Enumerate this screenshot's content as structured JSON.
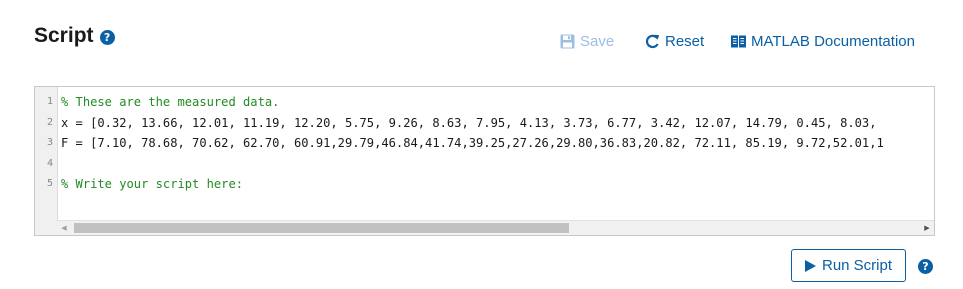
{
  "header": {
    "title": "Script",
    "help_icon": "question-circle-icon",
    "save_label": "Save",
    "reset_label": "Reset",
    "doc_label": "MATLAB Documentation"
  },
  "editor": {
    "lines": [
      {
        "num": "1",
        "text": "% These are the measured data.",
        "comment": true
      },
      {
        "num": "2",
        "text": "x = [0.32, 13.66, 12.01, 11.19, 12.20, 5.75, 9.26, 8.63, 7.95, 4.13, 3.73, 6.77, 3.42, 12.07, 14.79, 0.45, 8.03,",
        "comment": false
      },
      {
        "num": "3",
        "text": "F = [7.10, 78.68, 70.62, 62.70, 60.91,29.79,46.84,41.74,39.25,27.26,29.80,36.83,20.82, 72.11, 85.19, 9.72,52.01,1",
        "comment": false
      },
      {
        "num": "4",
        "text": "",
        "comment": false
      },
      {
        "num": "5",
        "text": "% Write your script here:",
        "comment": true
      }
    ]
  },
  "actions": {
    "run_label": "Run Script"
  },
  "colors": {
    "accent": "#0b5fa5",
    "disabled": "#9cbfe0",
    "comment": "#228b22"
  }
}
